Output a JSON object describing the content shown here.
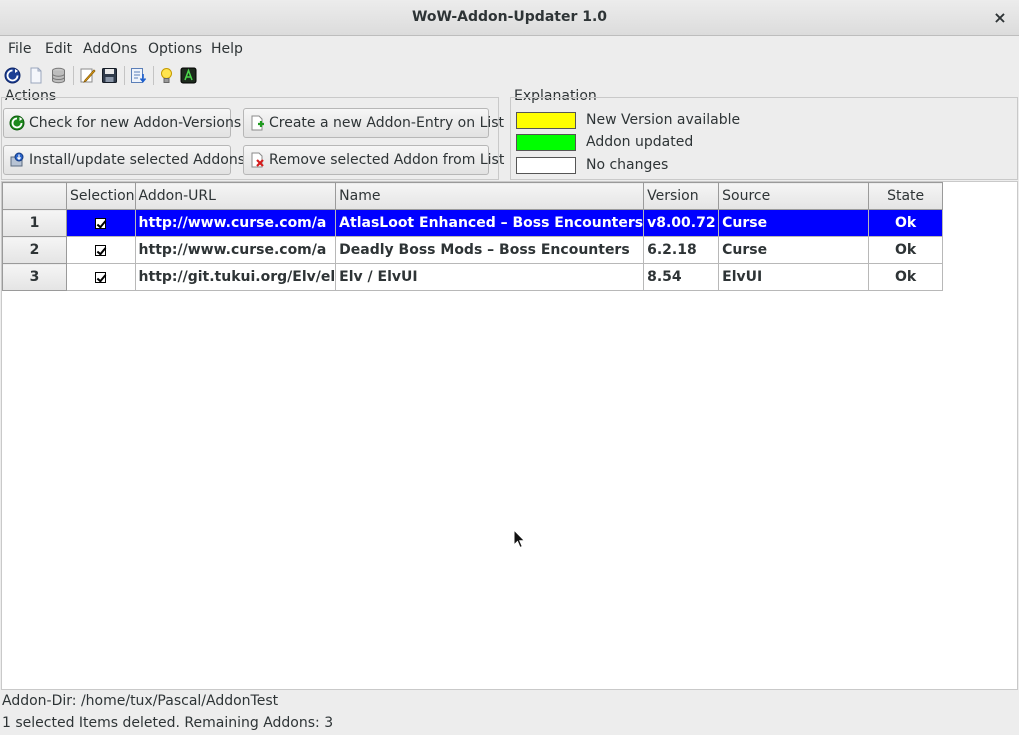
{
  "window": {
    "title": "WoW-Addon-Updater 1.0",
    "close_glyph": "×"
  },
  "menubar": {
    "items": [
      "File",
      "Edit",
      "AddOns",
      "Options",
      "Help"
    ]
  },
  "toolbar": {
    "icons": [
      "refresh-icon",
      "new-document-icon",
      "database-icon",
      "edit-icon",
      "save-icon",
      "import-icon",
      "lightbulb-icon",
      "terminal-icon"
    ]
  },
  "actions": {
    "label": "Actions",
    "check_label": "Check for new Addon-Versions",
    "create_label": "Create a new Addon-Entry on List",
    "install_label": "Install/update selected Addons",
    "remove_label": "Remove selected Addon from List"
  },
  "explanation": {
    "label": "Explanation",
    "items": [
      {
        "label": "New Version available",
        "color": "#ffff00"
      },
      {
        "label": "Addon updated",
        "color": "#00ff00"
      },
      {
        "label": "No changes",
        "color": "#ffffff"
      }
    ]
  },
  "table": {
    "columns": [
      "",
      "Selection",
      "Addon-URL",
      "Name",
      "Version",
      "Source",
      "State"
    ],
    "rows": [
      {
        "num": "1",
        "checked": true,
        "url": "http://www.curse.com/a",
        "name": "AtlasLoot Enhanced – Boss Encounters",
        "version": "v8.00.72",
        "source": "Curse",
        "state": "Ok",
        "selected": true
      },
      {
        "num": "2",
        "checked": true,
        "url": "http://www.curse.com/a",
        "name": "Deadly Boss Mods – Boss Encounters",
        "version": "6.2.18",
        "source": "Curse",
        "state": "Ok",
        "selected": false
      },
      {
        "num": "3",
        "checked": true,
        "url": "http://git.tukui.org/Elv/el",
        "name": "Elv / ElvUI",
        "version": "8.54",
        "source": "ElvUI",
        "state": "Ok",
        "selected": false
      }
    ],
    "selection_color": "#0000ff"
  },
  "status": {
    "addon_dir": "Addon-Dir: /home/tux/Pascal/AddonTest",
    "message": "1 selected Items deleted. Remaining Addons: 3"
  }
}
